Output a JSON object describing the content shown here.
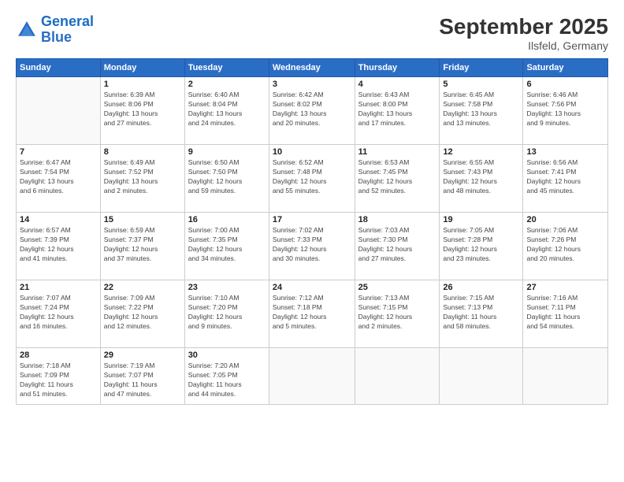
{
  "logo": {
    "line1": "General",
    "line2": "Blue"
  },
  "title": "September 2025",
  "location": "Ilsfeld, Germany",
  "days_header": [
    "Sunday",
    "Monday",
    "Tuesday",
    "Wednesday",
    "Thursday",
    "Friday",
    "Saturday"
  ],
  "weeks": [
    [
      {
        "day": "",
        "info": ""
      },
      {
        "day": "1",
        "info": "Sunrise: 6:39 AM\nSunset: 8:06 PM\nDaylight: 13 hours\nand 27 minutes."
      },
      {
        "day": "2",
        "info": "Sunrise: 6:40 AM\nSunset: 8:04 PM\nDaylight: 13 hours\nand 24 minutes."
      },
      {
        "day": "3",
        "info": "Sunrise: 6:42 AM\nSunset: 8:02 PM\nDaylight: 13 hours\nand 20 minutes."
      },
      {
        "day": "4",
        "info": "Sunrise: 6:43 AM\nSunset: 8:00 PM\nDaylight: 13 hours\nand 17 minutes."
      },
      {
        "day": "5",
        "info": "Sunrise: 6:45 AM\nSunset: 7:58 PM\nDaylight: 13 hours\nand 13 minutes."
      },
      {
        "day": "6",
        "info": "Sunrise: 6:46 AM\nSunset: 7:56 PM\nDaylight: 13 hours\nand 9 minutes."
      }
    ],
    [
      {
        "day": "7",
        "info": "Sunrise: 6:47 AM\nSunset: 7:54 PM\nDaylight: 13 hours\nand 6 minutes."
      },
      {
        "day": "8",
        "info": "Sunrise: 6:49 AM\nSunset: 7:52 PM\nDaylight: 13 hours\nand 2 minutes."
      },
      {
        "day": "9",
        "info": "Sunrise: 6:50 AM\nSunset: 7:50 PM\nDaylight: 12 hours\nand 59 minutes."
      },
      {
        "day": "10",
        "info": "Sunrise: 6:52 AM\nSunset: 7:48 PM\nDaylight: 12 hours\nand 55 minutes."
      },
      {
        "day": "11",
        "info": "Sunrise: 6:53 AM\nSunset: 7:45 PM\nDaylight: 12 hours\nand 52 minutes."
      },
      {
        "day": "12",
        "info": "Sunrise: 6:55 AM\nSunset: 7:43 PM\nDaylight: 12 hours\nand 48 minutes."
      },
      {
        "day": "13",
        "info": "Sunrise: 6:56 AM\nSunset: 7:41 PM\nDaylight: 12 hours\nand 45 minutes."
      }
    ],
    [
      {
        "day": "14",
        "info": "Sunrise: 6:57 AM\nSunset: 7:39 PM\nDaylight: 12 hours\nand 41 minutes."
      },
      {
        "day": "15",
        "info": "Sunrise: 6:59 AM\nSunset: 7:37 PM\nDaylight: 12 hours\nand 37 minutes."
      },
      {
        "day": "16",
        "info": "Sunrise: 7:00 AM\nSunset: 7:35 PM\nDaylight: 12 hours\nand 34 minutes."
      },
      {
        "day": "17",
        "info": "Sunrise: 7:02 AM\nSunset: 7:33 PM\nDaylight: 12 hours\nand 30 minutes."
      },
      {
        "day": "18",
        "info": "Sunrise: 7:03 AM\nSunset: 7:30 PM\nDaylight: 12 hours\nand 27 minutes."
      },
      {
        "day": "19",
        "info": "Sunrise: 7:05 AM\nSunset: 7:28 PM\nDaylight: 12 hours\nand 23 minutes."
      },
      {
        "day": "20",
        "info": "Sunrise: 7:06 AM\nSunset: 7:26 PM\nDaylight: 12 hours\nand 20 minutes."
      }
    ],
    [
      {
        "day": "21",
        "info": "Sunrise: 7:07 AM\nSunset: 7:24 PM\nDaylight: 12 hours\nand 16 minutes."
      },
      {
        "day": "22",
        "info": "Sunrise: 7:09 AM\nSunset: 7:22 PM\nDaylight: 12 hours\nand 12 minutes."
      },
      {
        "day": "23",
        "info": "Sunrise: 7:10 AM\nSunset: 7:20 PM\nDaylight: 12 hours\nand 9 minutes."
      },
      {
        "day": "24",
        "info": "Sunrise: 7:12 AM\nSunset: 7:18 PM\nDaylight: 12 hours\nand 5 minutes."
      },
      {
        "day": "25",
        "info": "Sunrise: 7:13 AM\nSunset: 7:15 PM\nDaylight: 12 hours\nand 2 minutes."
      },
      {
        "day": "26",
        "info": "Sunrise: 7:15 AM\nSunset: 7:13 PM\nDaylight: 11 hours\nand 58 minutes."
      },
      {
        "day": "27",
        "info": "Sunrise: 7:16 AM\nSunset: 7:11 PM\nDaylight: 11 hours\nand 54 minutes."
      }
    ],
    [
      {
        "day": "28",
        "info": "Sunrise: 7:18 AM\nSunset: 7:09 PM\nDaylight: 11 hours\nand 51 minutes."
      },
      {
        "day": "29",
        "info": "Sunrise: 7:19 AM\nSunset: 7:07 PM\nDaylight: 11 hours\nand 47 minutes."
      },
      {
        "day": "30",
        "info": "Sunrise: 7:20 AM\nSunset: 7:05 PM\nDaylight: 11 hours\nand 44 minutes."
      },
      {
        "day": "",
        "info": ""
      },
      {
        "day": "",
        "info": ""
      },
      {
        "day": "",
        "info": ""
      },
      {
        "day": "",
        "info": ""
      }
    ]
  ]
}
